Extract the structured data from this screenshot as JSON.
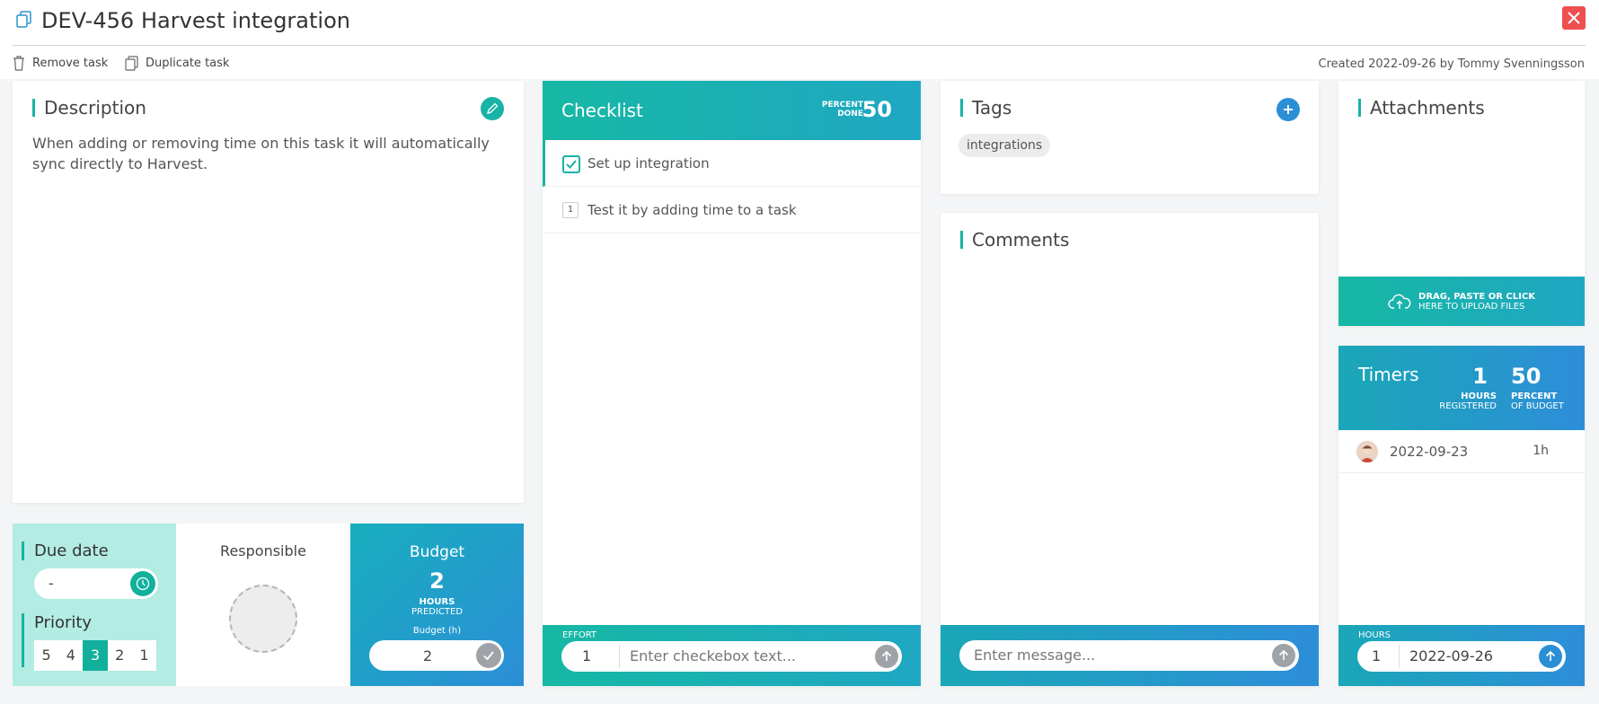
{
  "header": {
    "task_key": "DEV-456",
    "task_title": "Harvest integration",
    "copy_icon": "copy-icon",
    "close_icon": "close-icon"
  },
  "actions": {
    "remove_label": "Remove task",
    "duplicate_label": "Duplicate task",
    "created_text": "Created 2022-09-26 by Tommy Svenningsson"
  },
  "description": {
    "title": "Description",
    "text": "When adding or removing time on this task it will automatically sync directly to Harvest.",
    "edit_icon": "pencil-icon"
  },
  "due": {
    "title": "Due date",
    "value": "-",
    "clock_icon": "clock-icon"
  },
  "priority": {
    "title": "Priority",
    "options": [
      "5",
      "4",
      "3",
      "2",
      "1"
    ],
    "selected": "3"
  },
  "responsible": {
    "title": "Responsible"
  },
  "budget": {
    "title": "Budget",
    "hours": "2",
    "hours_label": "HOURS",
    "predicted_label": "PREDICTED",
    "input_label": "Budget (h)",
    "input_value": "2"
  },
  "checklist": {
    "title": "Checklist",
    "percent_label_1": "PERCENT",
    "percent_label_2": "DONE",
    "percent_value": "50",
    "items": [
      {
        "text": "Set up integration",
        "done": true
      },
      {
        "text": "Test it by adding time to a task",
        "done": false,
        "effort": "1"
      }
    ],
    "effort_label": "EFFORT",
    "effort_value": "1",
    "input_placeholder": "Enter checkebox text..."
  },
  "tags": {
    "title": "Tags",
    "items": [
      "integrations"
    ],
    "add_icon": "plus-icon"
  },
  "comments": {
    "title": "Comments",
    "input_placeholder": "Enter message..."
  },
  "attachments": {
    "title": "Attachments",
    "upload_line1": "DRAG, PASTE OR CLICK",
    "upload_line2": "HERE TO UPLOAD FILES",
    "upload_icon": "cloud-upload-icon"
  },
  "timers": {
    "title": "Timers",
    "hours_value": "1",
    "hours_label": "HOURS",
    "registered_label": "REGISTERED",
    "percent_value": "50",
    "percent_label": "PERCENT",
    "of_budget_label": "OF BUDGET",
    "entries": [
      {
        "date": "2022-09-23",
        "duration": "1h"
      }
    ],
    "hours_input_label": "HOURS",
    "hours_input_value": "1",
    "date_input_value": "2022-09-26"
  },
  "colors": {
    "accent_teal": "#17b3a6",
    "accent_blue": "#2d8ed8",
    "close_red": "#ef4f4f",
    "due_panel_bg": "#b3ece3"
  }
}
